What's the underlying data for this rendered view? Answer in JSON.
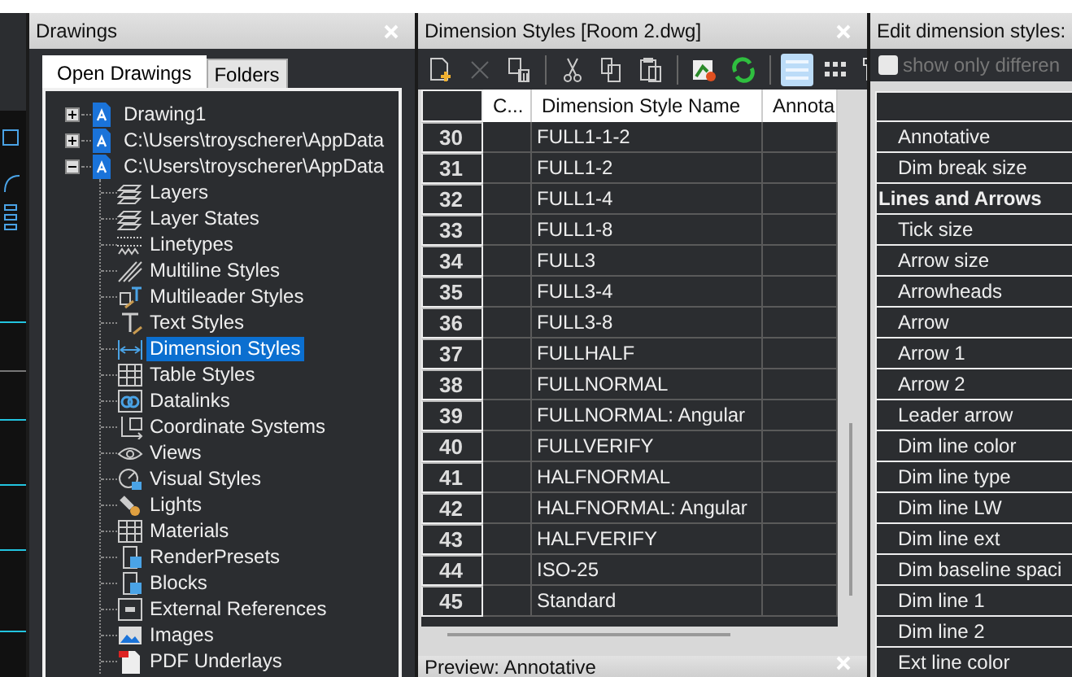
{
  "drawings_panel": {
    "title": "Drawings",
    "tabs": [
      {
        "label": "Open Drawings",
        "selected": true
      },
      {
        "label": "Folders",
        "selected": false
      }
    ],
    "tree": [
      {
        "label": "Drawing1",
        "expanded": false,
        "selected": false
      },
      {
        "label": "C:\\Users\\troyscherer\\AppData",
        "expanded": false,
        "selected": false
      },
      {
        "label": "C:\\Users\\troyscherer\\AppData",
        "expanded": true,
        "selected": false,
        "children": [
          {
            "label": "Layers",
            "selected": false
          },
          {
            "label": "Layer States",
            "selected": false
          },
          {
            "label": "Linetypes",
            "selected": false
          },
          {
            "label": "Multiline Styles",
            "selected": false
          },
          {
            "label": "Multileader Styles",
            "selected": false
          },
          {
            "label": "Text Styles",
            "selected": false
          },
          {
            "label": "Dimension Styles",
            "selected": true
          },
          {
            "label": "Table Styles",
            "selected": false
          },
          {
            "label": "Datalinks",
            "selected": false
          },
          {
            "label": "Coordinate Systems",
            "selected": false
          },
          {
            "label": "Views",
            "selected": false
          },
          {
            "label": "Visual Styles",
            "selected": false
          },
          {
            "label": "Lights",
            "selected": false
          },
          {
            "label": "Materials",
            "selected": false
          },
          {
            "label": "RenderPresets",
            "selected": false
          },
          {
            "label": "Blocks",
            "selected": false
          },
          {
            "label": "External References",
            "selected": false
          },
          {
            "label": "Images",
            "selected": false
          },
          {
            "label": "PDF Underlays",
            "selected": false
          }
        ]
      }
    ]
  },
  "styles_panel": {
    "title": "Dimension Styles [Room 2.dwg]",
    "toolbar": [
      {
        "kind": "new",
        "disabled": false
      },
      {
        "kind": "delete",
        "disabled": true
      },
      {
        "kind": "purge",
        "disabled": false
      },
      {
        "kind": "separator"
      },
      {
        "kind": "cut",
        "disabled": false
      },
      {
        "kind": "copy",
        "disabled": false
      },
      {
        "kind": "paste",
        "disabled": false
      },
      {
        "kind": "separator"
      },
      {
        "kind": "import",
        "disabled": false
      },
      {
        "kind": "refresh",
        "disabled": false
      },
      {
        "kind": "separator"
      }
    ],
    "view_modes": [
      {
        "kind": "list",
        "selected": true
      },
      {
        "kind": "tiles",
        "selected": false
      },
      {
        "kind": "tree",
        "selected": false
      }
    ],
    "table": {
      "columns": [
        "C...",
        "Dimension Style Name",
        "Annota"
      ],
      "rows": [
        {
          "index": "30",
          "name": "FULL1-1-2"
        },
        {
          "index": "31",
          "name": "FULL1-2"
        },
        {
          "index": "32",
          "name": "FULL1-4"
        },
        {
          "index": "33",
          "name": "FULL1-8"
        },
        {
          "index": "34",
          "name": "FULL3"
        },
        {
          "index": "35",
          "name": "FULL3-4"
        },
        {
          "index": "36",
          "name": "FULL3-8"
        },
        {
          "index": "37",
          "name": "FULLHALF"
        },
        {
          "index": "38",
          "name": "FULLNORMAL"
        },
        {
          "index": "39",
          "name": "FULLNORMAL: Angular"
        },
        {
          "index": "40",
          "name": "FULLVERIFY"
        },
        {
          "index": "41",
          "name": "HALFNORMAL"
        },
        {
          "index": "42",
          "name": "HALFNORMAL: Angular"
        },
        {
          "index": "43",
          "name": "HALFVERIFY"
        },
        {
          "index": "44",
          "name": "ISO-25"
        },
        {
          "index": "45",
          "name": "Standard"
        }
      ]
    },
    "preview": {
      "title": "Preview: Annotative"
    }
  },
  "edit_panel": {
    "title": "Edit dimension styles:",
    "filter": {
      "label": "show only differen",
      "checked": false,
      "disabled": true
    },
    "properties": [
      {
        "kind": "property",
        "label": "Annotative"
      },
      {
        "kind": "property",
        "label": "Dim break size"
      },
      {
        "kind": "section",
        "label": "Lines and Arrows"
      },
      {
        "kind": "property",
        "label": "Tick size"
      },
      {
        "kind": "property",
        "label": "Arrow size"
      },
      {
        "kind": "property",
        "label": "Arrowheads"
      },
      {
        "kind": "property",
        "label": "Arrow"
      },
      {
        "kind": "property",
        "label": "Arrow 1"
      },
      {
        "kind": "property",
        "label": "Arrow 2"
      },
      {
        "kind": "property",
        "label": "Leader arrow"
      },
      {
        "kind": "property",
        "label": "Dim line color"
      },
      {
        "kind": "property",
        "label": "Dim line type"
      },
      {
        "kind": "property",
        "label": "Dim line LW"
      },
      {
        "kind": "property",
        "label": "Dim line ext"
      },
      {
        "kind": "property",
        "label": "Dim baseline spaci"
      },
      {
        "kind": "property",
        "label": "Dim line 1"
      },
      {
        "kind": "property",
        "label": "Dim line 2"
      },
      {
        "kind": "property",
        "label": "Ext line color"
      }
    ]
  }
}
